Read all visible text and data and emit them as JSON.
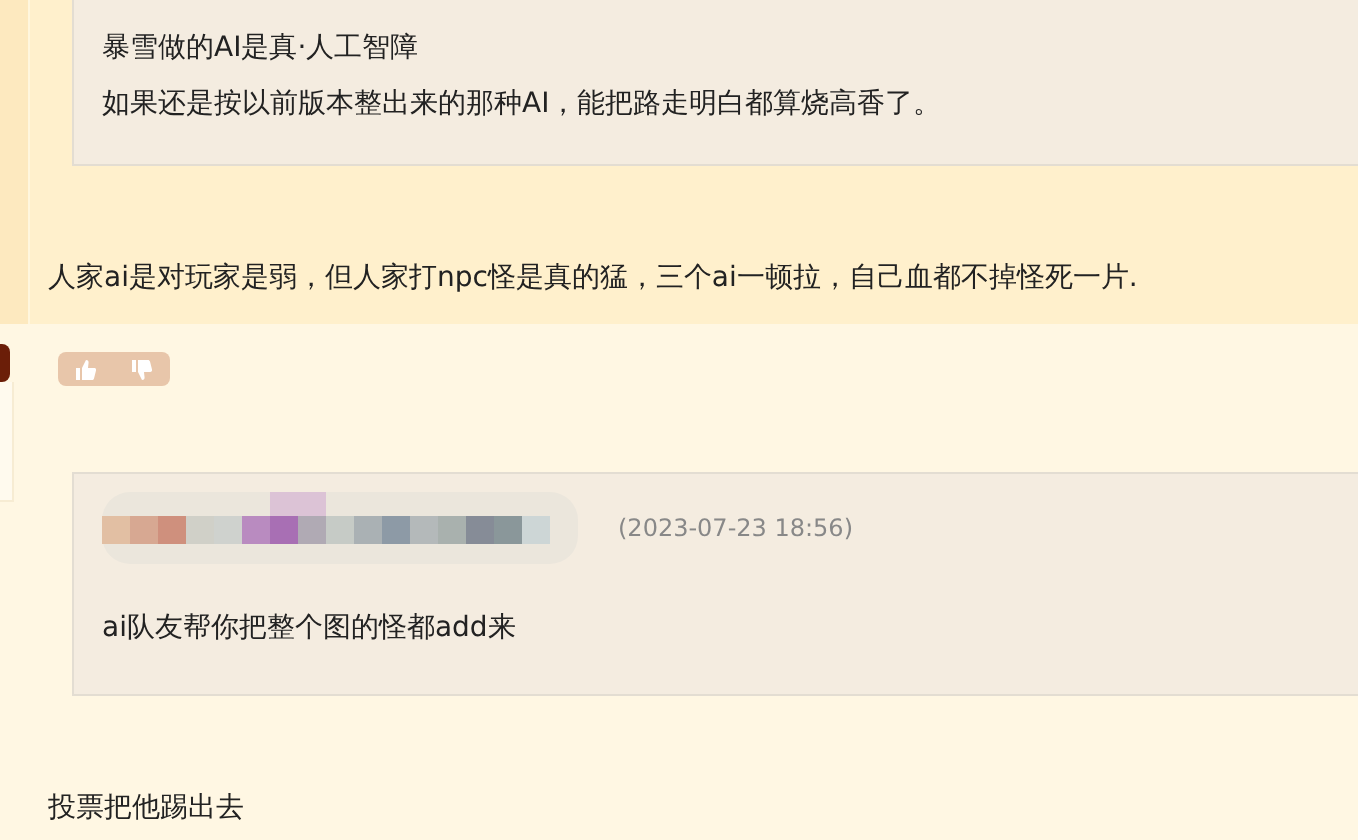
{
  "quote": {
    "lines": [
      "暴雪做的AI是真·人工智障",
      "如果还是按以前版本整出来的那种AI，能把路走明白都算烧高香了。"
    ]
  },
  "comment": {
    "text": "人家ai是对玩家是弱，但人家打npc怪是真的猛，三个ai一顿拉，自己血都不掉怪死一片."
  },
  "reply": {
    "timestamp": "(2023-07-23 18:56)",
    "text": "ai队友帮你把整个图的怪都add来"
  },
  "next_comment": {
    "text": "投票把他踢出去"
  }
}
